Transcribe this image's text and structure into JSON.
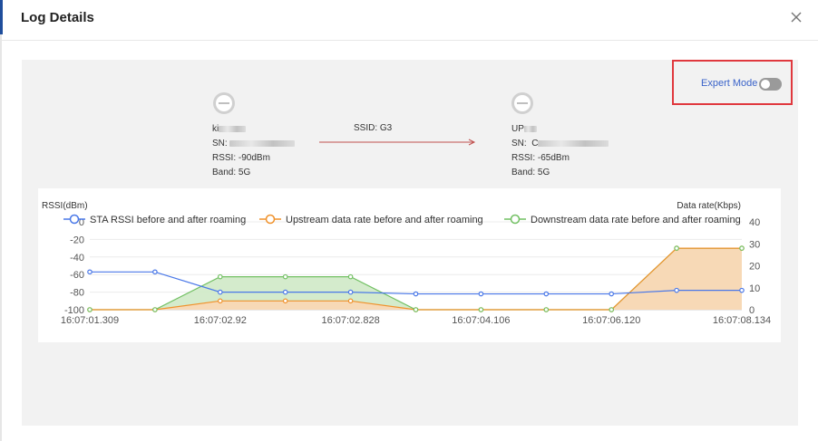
{
  "dialog": {
    "title": "Log Details"
  },
  "expert_mode": {
    "label": "Expert Mode",
    "enabled": false
  },
  "source_device": {
    "name_prefix": "ki",
    "sn_label": "SN:",
    "rssi": "RSSI: -90dBm",
    "band": "Band: 5G"
  },
  "target_device": {
    "name_prefix": "UP",
    "sn_label": "SN:",
    "sn_prefix": "C",
    "rssi": "RSSI:  -65dBm",
    "band": "Band: 5G"
  },
  "ssid": "SSID:  G3",
  "colors": {
    "sta_rssi": "#4a78e8",
    "upstream": "#f0922c",
    "downstream": "#72c063",
    "upstream_fill": "#fbd7b4",
    "downstream_fill": "#cfe9c7",
    "expert_box": "#e0383e",
    "arrow": "#c0504d"
  },
  "chart_data": {
    "type": "line",
    "ylabel": "RSSI(dBm)",
    "y2label": "Data rate(Kbps)",
    "ylim": [
      -100,
      0
    ],
    "y2lim": [
      0,
      40
    ],
    "yticks": [
      "0",
      "-20",
      "-40",
      "-60",
      "-80",
      "-100"
    ],
    "y2ticks": [
      "40",
      "30",
      "20",
      "10",
      "0"
    ],
    "x": [
      "16:07:01.309",
      "16:07:02.92",
      "16:07:02.828",
      "16:07:04.106",
      "16:07:06.120",
      "16:07:08.134"
    ],
    "x_tick_labels": [
      "16:07:01.309",
      "16:07:02.92",
      "16:07:02.828",
      "16:07:04.106",
      "16:07:06.120",
      "16:07:08.134"
    ],
    "grid": true,
    "legend_position": "top",
    "series": [
      {
        "name": "STA RSSI before and after roaming",
        "axis": "left",
        "values": [
          -57,
          -57,
          -80,
          -80,
          -80,
          -82,
          -82,
          -82,
          -82,
          -78,
          -78
        ]
      },
      {
        "name": "Upstream data rate before and after roaming",
        "axis": "right",
        "values": [
          0,
          0,
          4,
          4,
          4,
          0,
          0,
          0,
          0,
          28,
          28
        ],
        "area": true
      },
      {
        "name": "Downstream data rate before and after roaming",
        "axis": "right",
        "values": [
          0,
          0,
          15,
          15,
          15,
          0,
          0,
          0,
          0,
          28,
          28
        ],
        "area": true
      }
    ]
  }
}
